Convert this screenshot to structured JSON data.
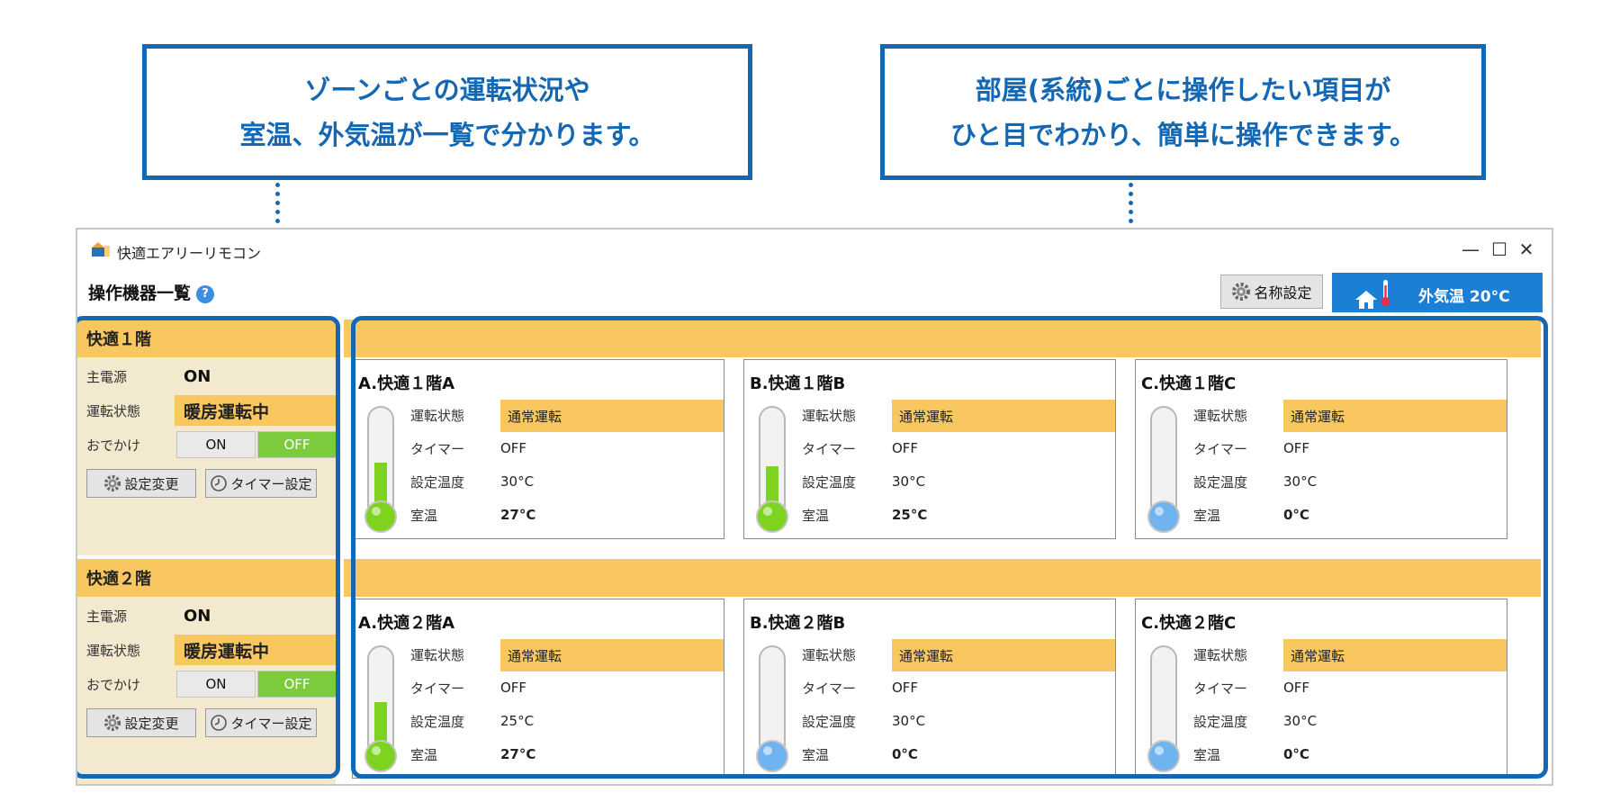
{
  "callouts": {
    "left": [
      "ゾーンごとの運転状況や",
      "室温、外気温が一覧で分かります。"
    ],
    "right": [
      "部屋(系統)ごとに操作したい項目が",
      "ひと目でわかり、簡単に操作できます。"
    ]
  },
  "window": {
    "title": "快適エアリーリモコン",
    "minimize": "—",
    "maximize": "☐",
    "close": "✕"
  },
  "header": {
    "section_title": "操作機器一覧",
    "help": "?",
    "name_button": "名称設定",
    "outside_temp": "外気温 20°C"
  },
  "zones": [
    {
      "name": "快適１階",
      "power_label": "主電源",
      "power_value": "ON",
      "status_label": "運転状態",
      "status_value": "暖房運転中",
      "away_label": "おでかけ",
      "away_on": "ON",
      "away_off": "OFF",
      "settings_button": "設定変更",
      "timer_button": "タイマー設定"
    },
    {
      "name": "快適２階",
      "power_label": "主電源",
      "power_value": "ON",
      "status_label": "運転状態",
      "status_value": "暖房運転中",
      "away_label": "おでかけ",
      "away_on": "ON",
      "away_off": "OFF",
      "settings_button": "設定変更",
      "timer_button": "タイマー設定"
    }
  ],
  "row_labels": {
    "status": "運転状態",
    "timer": "タイマー",
    "set_temp": "設定温度",
    "room_temp": "室温"
  },
  "rooms": [
    [
      {
        "title": "A.快適１階A",
        "status": "通常運転",
        "timer": "OFF",
        "set_temp": "30°C",
        "room_temp": "27°C"
      },
      {
        "title": "B.快適１階B",
        "status": "通常運転",
        "timer": "OFF",
        "set_temp": "30°C",
        "room_temp": "25°C"
      },
      {
        "title": "C.快適１階C",
        "status": "通常運転",
        "timer": "OFF",
        "set_temp": "30°C",
        "room_temp": "0°C"
      }
    ],
    [
      {
        "title": "A.快適２階A",
        "status": "通常運転",
        "timer": "OFF",
        "set_temp": "25°C",
        "room_temp": "27°C"
      },
      {
        "title": "B.快適２階B",
        "status": "通常運転",
        "timer": "OFF",
        "set_temp": "30°C",
        "room_temp": "0°C"
      },
      {
        "title": "C.快適２階C",
        "status": "通常運転",
        "timer": "OFF",
        "set_temp": "30°C",
        "room_temp": "0°C"
      }
    ]
  ],
  "colors": {
    "accent": "#1468b3",
    "band": "#f9c760",
    "off_green": "#7ccb3d",
    "thermo_green": "#7ed321",
    "thermo_blue": "#6fb3ef"
  }
}
